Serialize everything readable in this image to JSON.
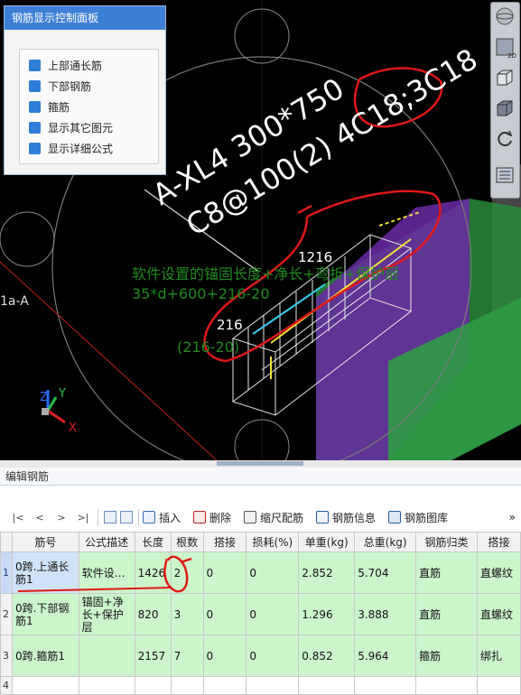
{
  "viewport": {
    "annotation_line1": "A-XL4 300*750",
    "annotation_line2": "C8@100(2) 4C18;3C18",
    "dim_top": "1216",
    "dim_left": "216",
    "formula_line1": "软件设置的锚固长度+净长+弯折+保护层",
    "formula_line2": "35*d+600+216-20",
    "formula_line3": "(216-20)",
    "axis_label": "1a-A",
    "axis_x": "X",
    "axis_y": "Y",
    "axis_z": "Z"
  },
  "control_panel": {
    "title": "钢筋显示控制面板",
    "options": [
      {
        "label": "上部通长筋",
        "checked": true
      },
      {
        "label": "下部钢筋",
        "checked": true
      },
      {
        "label": "箍筋",
        "checked": true
      },
      {
        "label": "显示其它图元",
        "checked": true
      },
      {
        "label": "显示详细公式",
        "checked": true
      }
    ]
  },
  "right_tools": {
    "tool2_label": "2D"
  },
  "editor": {
    "title": "编辑钢筋",
    "toolbar": {
      "nav_first": "|<",
      "nav_prev": "<",
      "nav_next": ">",
      "nav_last": ">|",
      "insert": "插入",
      "delete": "删除",
      "scale_rebar": "缩尺配筋",
      "rebar_info": "钢筋信息",
      "rebar_library": "钢筋图库",
      "more": "»"
    },
    "columns": [
      "筋号",
      "公式描述",
      "长度",
      "根数",
      "搭接",
      "损耗(%)",
      "单重(kg)",
      "总重(kg)",
      "钢筋归类",
      "搭接"
    ],
    "rows": [
      {
        "num": "1",
        "name": "0跨.上通长筋1",
        "formula": "软件设…",
        "length": "1426",
        "count": "2",
        "lap": "0",
        "loss": "0",
        "unit_weight": "2.852",
        "total_weight": "5.704",
        "category": "直筋",
        "lap_type": "直螺纹"
      },
      {
        "num": "2",
        "name": "0跨.下部钢筋1",
        "formula": "锚固+净长+保护层",
        "length": "820",
        "count": "3",
        "lap": "0",
        "loss": "0",
        "unit_weight": "1.296",
        "total_weight": "3.888",
        "category": "直筋",
        "lap_type": "直螺纹"
      },
      {
        "num": "3",
        "name": "0跨.箍筋1",
        "formula": "",
        "length": "2157",
        "count": "7",
        "lap": "0",
        "loss": "0",
        "unit_weight": "0.852",
        "total_weight": "5.964",
        "category": "箍筋",
        "lap_type": "绑扎"
      },
      {
        "num": "4",
        "name": "",
        "formula": "",
        "length": "",
        "count": "",
        "lap": "",
        "loss": "",
        "unit_weight": "",
        "total_weight": "",
        "category": "",
        "lap_type": ""
      }
    ]
  },
  "colors": {
    "panel_title_bg": "#3d7fd6",
    "checkbox": "#2f7ed8",
    "row_green": "#ccf5cc",
    "annotation_red": "#e01818",
    "formula_green": "#1f8a1f"
  }
}
